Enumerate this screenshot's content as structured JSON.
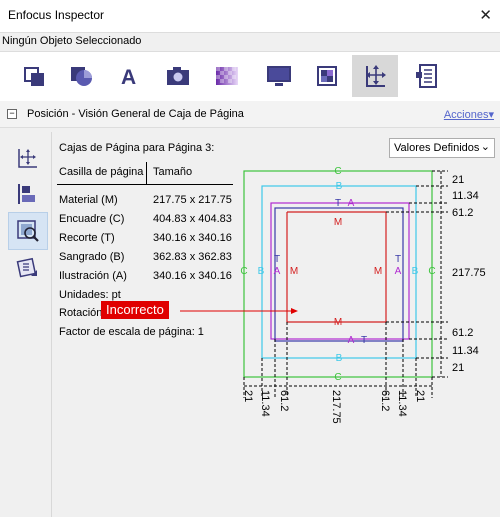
{
  "window": {
    "title": "Enfocus Inspector",
    "close_label": "✕"
  },
  "status_text": "Ningún Objeto Seleccionado",
  "section": {
    "toggle": "−",
    "label": "Posición - Visión General de Caja de Página",
    "acciones": "Acciones▾"
  },
  "panel": {
    "title": "Cajas de Página para Página 3:",
    "dropdown_value": "Valores Definidos",
    "dropdown_arrow": "⌄",
    "headers": {
      "box": "Casilla de página",
      "size": "Tamaño"
    },
    "rows": [
      {
        "label": "Material (M)",
        "value": "217.75 x 217.75"
      },
      {
        "label": "Encuadre (C)",
        "value": "404.83 x 404.83"
      },
      {
        "label": "Recorte (T)",
        "value": "340.16 x 340.16"
      },
      {
        "label": "Sangrado (B)",
        "value": "362.83 x 362.83"
      },
      {
        "label": "Ilustración (A)",
        "value": "340.16 x 340.16"
      }
    ],
    "unidades": "Unidades: pt",
    "rotacion": "Rotación",
    "factor": "Factor de escala de página: 1",
    "badge": "Incorrecto"
  },
  "diagram": {
    "letters": {
      "crop": "C",
      "bleed": "B",
      "trim": "T",
      "art": "A",
      "media": "M"
    },
    "right_values": [
      "21",
      "11.34",
      "61.2",
      "217.75",
      "61.2",
      "11.34",
      "21"
    ],
    "bottom_values": [
      "21",
      "11.34",
      "61.2",
      "217.75",
      "61.2",
      "11.34",
      "21"
    ],
    "colors": {
      "crop": "#3cc33c",
      "bleed": "#3ec8e8",
      "trim": "#3a3aa8",
      "art": "#b02ad0",
      "media": "#d42020"
    }
  }
}
